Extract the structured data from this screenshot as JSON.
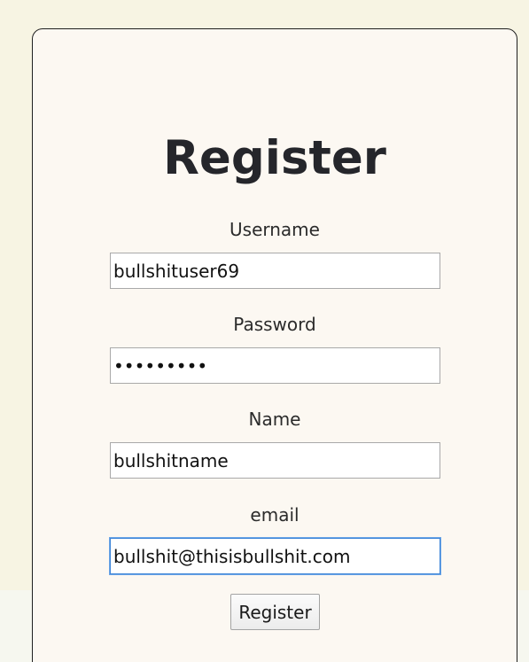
{
  "form": {
    "title": "Register",
    "username": {
      "label": "Username",
      "value": "bullshituser69"
    },
    "password": {
      "label": "Password",
      "value": "•••••••••"
    },
    "name": {
      "label": "Name",
      "value": "bullshitname"
    },
    "email": {
      "label": "email",
      "value": "bullshit@thisisbullshit.com"
    },
    "submit_label": "Register"
  }
}
